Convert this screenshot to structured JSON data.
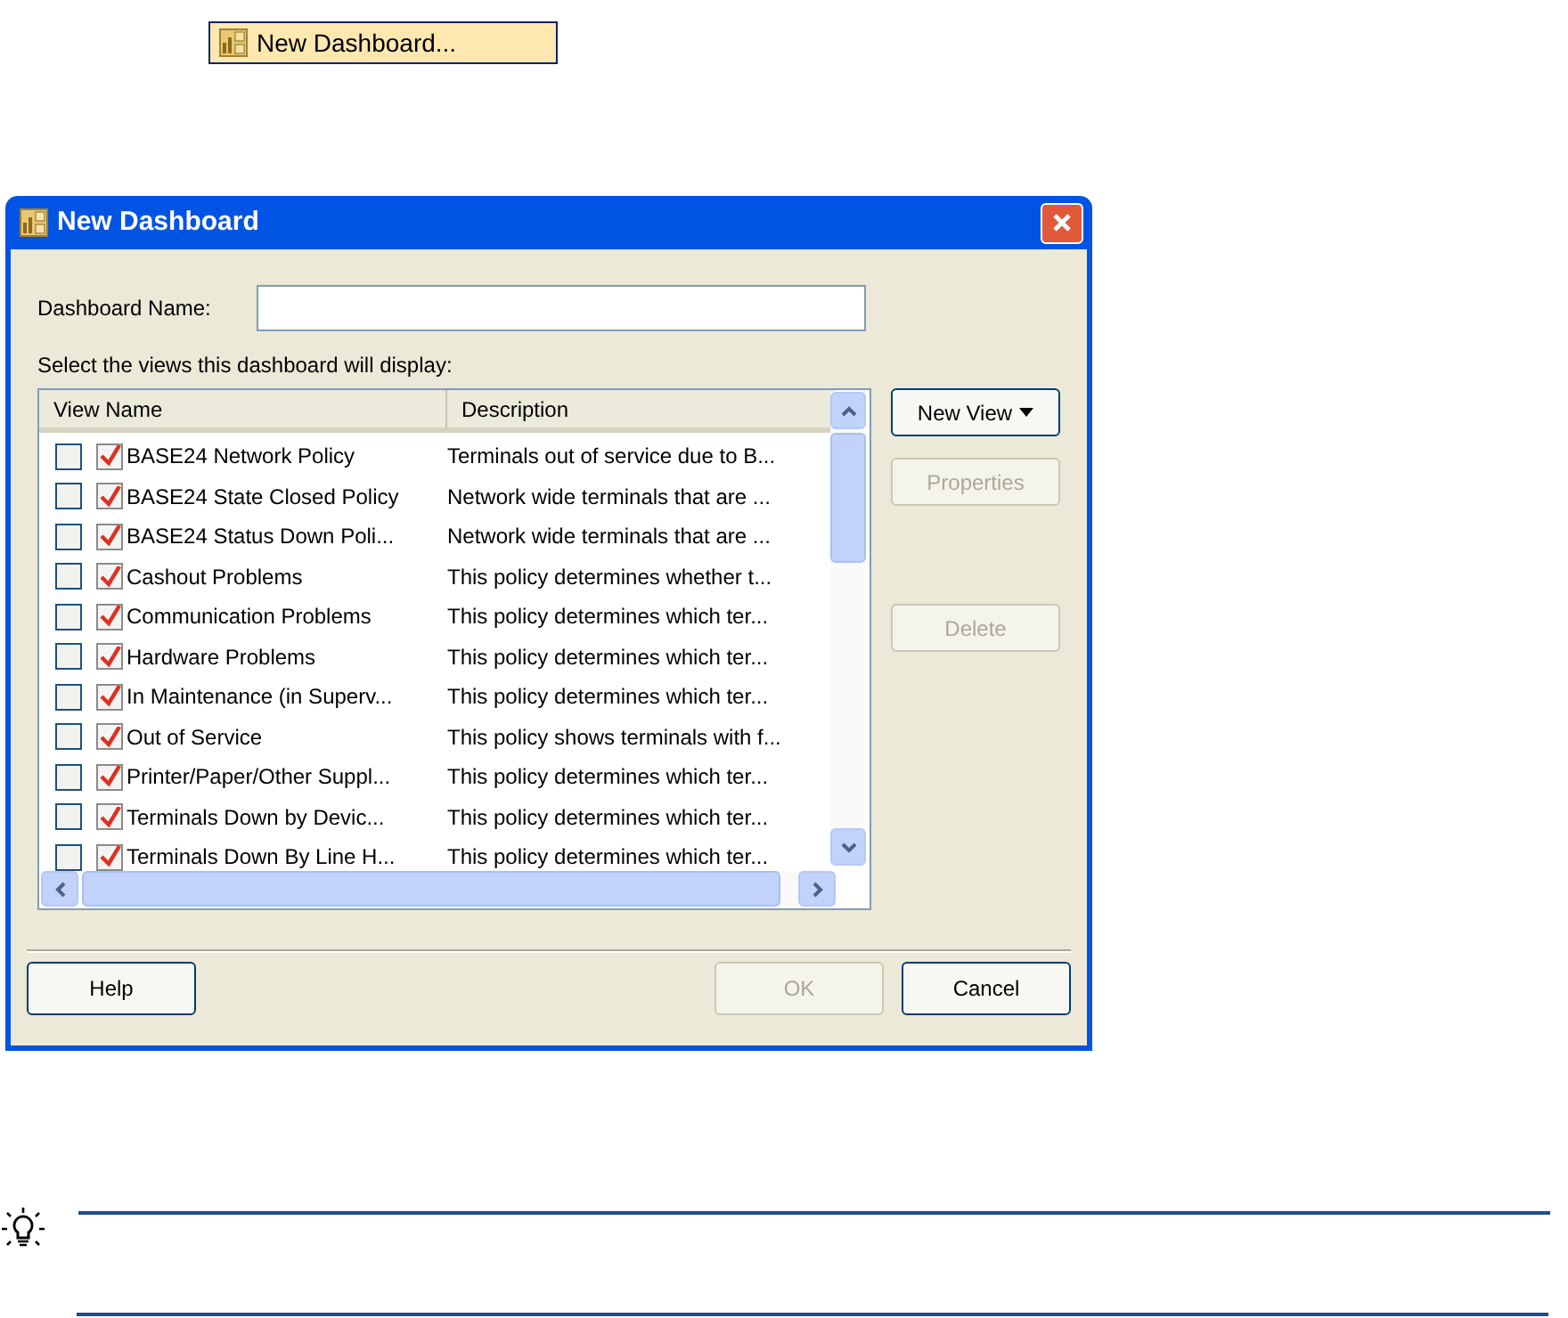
{
  "menu_button": {
    "label": "New Dashboard..."
  },
  "dialog": {
    "title": "New Dashboard",
    "name_field": {
      "label": "Dashboard Name:"
    },
    "views_label": {
      "label": "Select the views this dashboard will display:"
    },
    "table": {
      "columns": [
        "View Name",
        "Description"
      ],
      "rows": [
        {
          "checked": false,
          "active": true,
          "name": "BASE24 Network Policy",
          "description": "Terminals out of service due to B..."
        },
        {
          "checked": false,
          "active": true,
          "name": "BASE24 State Closed Policy",
          "description": "Network wide terminals that are ..."
        },
        {
          "checked": false,
          "active": true,
          "name": "BASE24 Status Down Poli...",
          "description": "Network wide terminals that are ..."
        },
        {
          "checked": false,
          "active": true,
          "name": "Cashout Problems",
          "description": "This policy determines whether t..."
        },
        {
          "checked": false,
          "active": true,
          "name": "Communication Problems",
          "description": "This policy determines which ter..."
        },
        {
          "checked": false,
          "active": true,
          "name": "Hardware Problems",
          "description": "This policy determines which ter..."
        },
        {
          "checked": false,
          "active": true,
          "name": "In Maintenance (in Superv...",
          "description": "This policy determines which ter..."
        },
        {
          "checked": false,
          "active": true,
          "name": "Out of Service",
          "description": "This policy shows terminals with f..."
        },
        {
          "checked": false,
          "active": true,
          "name": "Printer/Paper/Other Suppl...",
          "description": "This policy determines which ter..."
        },
        {
          "checked": false,
          "active": true,
          "name": "Terminals Down by Devic...",
          "description": "This policy determines which ter..."
        },
        {
          "checked": false,
          "active": true,
          "name": "Terminals Down By Line H...",
          "description": "This policy determines which ter..."
        }
      ]
    },
    "side_buttons": [
      {
        "label": "New View",
        "disabled": false,
        "dropdown": true
      },
      {
        "label": "Properties",
        "disabled": true,
        "dropdown": false
      },
      {
        "label": "Delete",
        "disabled": true,
        "dropdown": false
      }
    ],
    "footer_buttons": [
      {
        "label": "Help",
        "disabled": false
      },
      {
        "label": "OK",
        "disabled": true
      },
      {
        "label": "Cancel",
        "disabled": false
      }
    ]
  }
}
